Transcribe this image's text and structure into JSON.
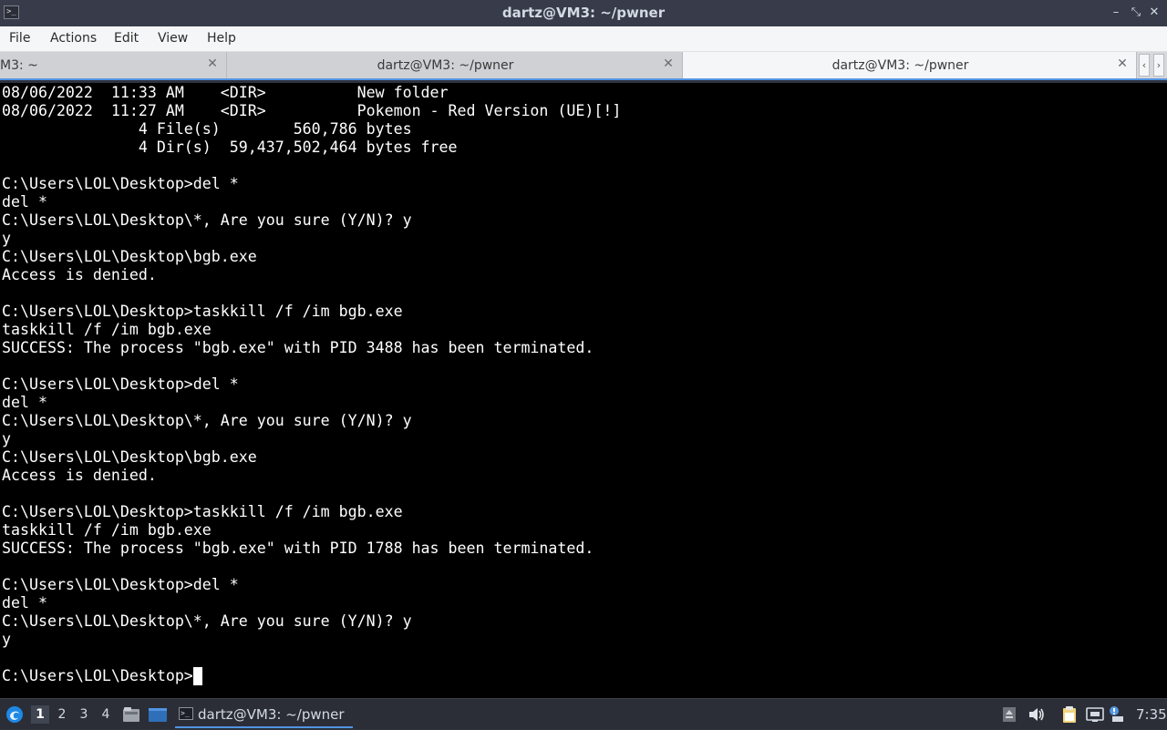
{
  "window": {
    "title": "dartz@VM3: ~/pwner",
    "minimize_glyph": "–",
    "maximize_glyph": "⤡",
    "close_glyph": "✕"
  },
  "menu": [
    "File",
    "Actions",
    "Edit",
    "View",
    "Help"
  ],
  "tabs": [
    {
      "label": "M3: ~",
      "close": "✕"
    },
    {
      "label": "dartz@VM3: ~/pwner",
      "close": "✕"
    },
    {
      "label": "dartz@VM3: ~/pwner",
      "close": "✕"
    }
  ],
  "tab_scroll": {
    "left": "‹",
    "right": "›"
  },
  "terminal": {
    "lines": [
      "08/06/2022  11:33 AM    <DIR>          New folder",
      "08/06/2022  11:27 AM    <DIR>          Pokemon - Red Version (UE)[!]",
      "               4 File(s)        560,786 bytes",
      "               4 Dir(s)  59,437,502,464 bytes free",
      "",
      "C:\\Users\\LOL\\Desktop>del *",
      "del *",
      "C:\\Users\\LOL\\Desktop\\*, Are you sure (Y/N)? y",
      "y",
      "C:\\Users\\LOL\\Desktop\\bgb.exe",
      "Access is denied.",
      "",
      "C:\\Users\\LOL\\Desktop>taskkill /f /im bgb.exe",
      "taskkill /f /im bgb.exe",
      "SUCCESS: The process \"bgb.exe\" with PID 3488 has been terminated.",
      "",
      "C:\\Users\\LOL\\Desktop>del *",
      "del *",
      "C:\\Users\\LOL\\Desktop\\*, Are you sure (Y/N)? y",
      "y",
      "C:\\Users\\LOL\\Desktop\\bgb.exe",
      "Access is denied.",
      "",
      "C:\\Users\\LOL\\Desktop>taskkill /f /im bgb.exe",
      "taskkill /f /im bgb.exe",
      "SUCCESS: The process \"bgb.exe\" with PID 1788 has been terminated.",
      "",
      "C:\\Users\\LOL\\Desktop>del *",
      "del *",
      "C:\\Users\\LOL\\Desktop\\*, Are you sure (Y/N)? y",
      "y",
      "",
      "C:\\Users\\LOL\\Desktop>"
    ]
  },
  "taskbar": {
    "workspaces": [
      "1",
      "2",
      "3",
      "4"
    ],
    "active_workspace": "1",
    "task_label": "dartz@VM3: ~/pwner",
    "clock": "7:35"
  },
  "colors": {
    "accent": "#5294e2",
    "terminal_bg": "#000000",
    "terminal_fg": "#ffffff",
    "titlebar": "#383c4a",
    "taskbar": "#2b2e37"
  }
}
